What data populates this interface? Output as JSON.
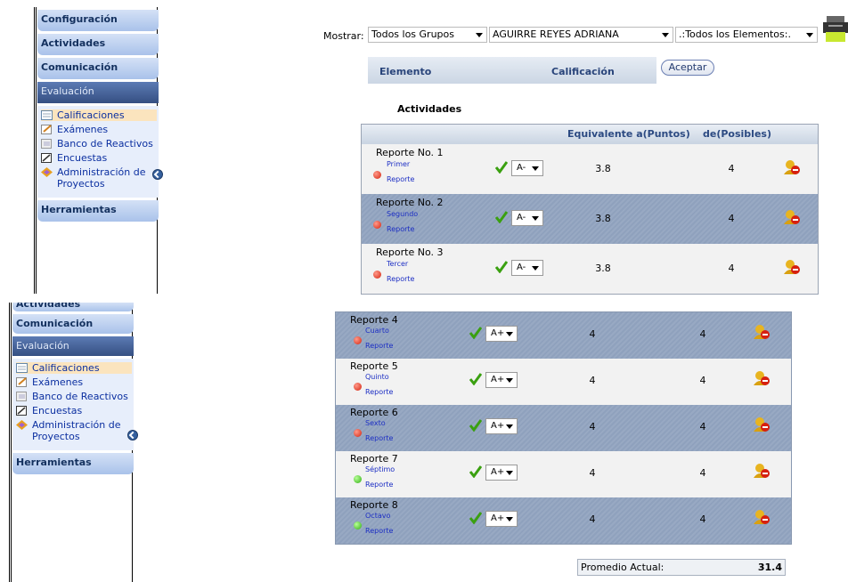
{
  "sidebar": {
    "sections": [
      "Configuración",
      "Actividades",
      "Comunicación",
      "Evaluación",
      "Herramientas"
    ],
    "items": [
      {
        "label": "Calificaciones",
        "icon": "grades-icon"
      },
      {
        "label": "Exámenes",
        "icon": "exam-icon"
      },
      {
        "label": "Banco de Reactivos",
        "icon": "bank-icon"
      },
      {
        "label": "Encuestas",
        "icon": "survey-icon"
      },
      {
        "label": "Administración de Proyectos",
        "icon": "projects-icon"
      }
    ],
    "partial_top": "Actividades"
  },
  "filter": {
    "label": "Mostrar:",
    "group": "Todos los Grupos",
    "student": "AGUIRRE REYES ADRIANA",
    "elements": ".:Todos los Elementos:."
  },
  "header_bar": {
    "col1": "Elemento",
    "col2": "Calificación",
    "button": "Aceptar"
  },
  "section_title": "Actividades",
  "table_headers": {
    "equiv": "Equivalente a(Puntos)",
    "possible": "de(Posibles)"
  },
  "rows_top": [
    {
      "name": "Reporte No. 1",
      "sub1": "Primer",
      "sub2": "Reporte",
      "grade": "A-",
      "points": "3.8",
      "possible": "4",
      "status": "red"
    },
    {
      "name": "Reporte No. 2",
      "sub1": "Segundo",
      "sub2": "Reporte",
      "grade": "A-",
      "points": "3.8",
      "possible": "4",
      "status": "red"
    },
    {
      "name": "Reporte No. 3",
      "sub1": "Tercer",
      "sub2": "Reporte",
      "grade": "A-",
      "points": "3.8",
      "possible": "4",
      "status": "red"
    }
  ],
  "rows_bottom": [
    {
      "name": "Reporte 4",
      "sub1": "Cuarto",
      "sub2": "Reporte",
      "grade": "A+",
      "points": "4",
      "possible": "4",
      "status": "red"
    },
    {
      "name": "Reporte 5",
      "sub1": "Quinto",
      "sub2": "Reporte",
      "grade": "A+",
      "points": "4",
      "possible": "4",
      "status": "red"
    },
    {
      "name": "Reporte 6",
      "sub1": "Sexto",
      "sub2": "Reporte",
      "grade": "A+",
      "points": "4",
      "possible": "4",
      "status": "red"
    },
    {
      "name": "Reporte 7",
      "sub1": "Séptimo",
      "sub2": "Reporte",
      "grade": "A+",
      "points": "4",
      "possible": "4",
      "status": "green"
    },
    {
      "name": "Reporte 8",
      "sub1": "Octavo",
      "sub2": "Reporte",
      "grade": "A+",
      "points": "4",
      "possible": "4",
      "status": "green"
    }
  ],
  "promedio": {
    "label": "Promedio Actual:",
    "value": "31.4"
  },
  "colors": {
    "link": "#1d2fc4",
    "header_text": "#2c4a82",
    "sidebar_active": "#354f82"
  }
}
